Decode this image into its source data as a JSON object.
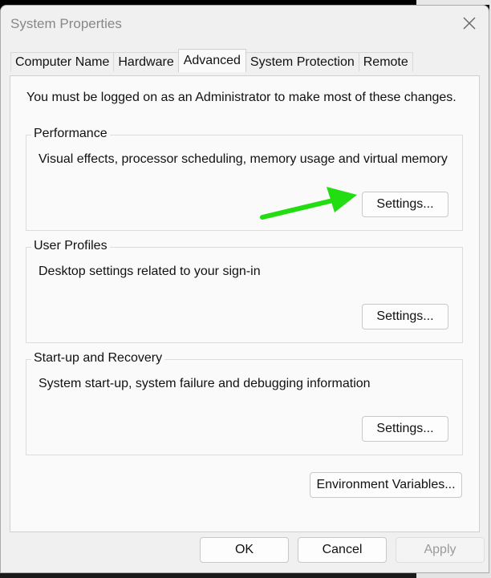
{
  "window": {
    "title": "System Properties"
  },
  "tabs": [
    {
      "label": "Computer Name",
      "active": false
    },
    {
      "label": "Hardware",
      "active": false
    },
    {
      "label": "Advanced",
      "active": true
    },
    {
      "label": "System Protection",
      "active": false
    },
    {
      "label": "Remote",
      "active": false
    }
  ],
  "advanced": {
    "admin_note": "You must be logged on as an Administrator to make most of these changes.",
    "groups": [
      {
        "title": "Performance",
        "description": "Visual effects, processor scheduling, memory usage and virtual memory",
        "button_label": "Settings..."
      },
      {
        "title": "User Profiles",
        "description": "Desktop settings related to your sign-in",
        "button_label": "Settings..."
      },
      {
        "title": "Start-up and Recovery",
        "description": "System start-up, system failure and debugging information",
        "button_label": "Settings..."
      }
    ],
    "env_button_label": "Environment Variables..."
  },
  "footer": {
    "ok_label": "OK",
    "cancel_label": "Cancel",
    "apply_label": "Apply"
  },
  "annotation": {
    "arrow_color": "#22dd11",
    "icon": "arrow-right-icon"
  }
}
